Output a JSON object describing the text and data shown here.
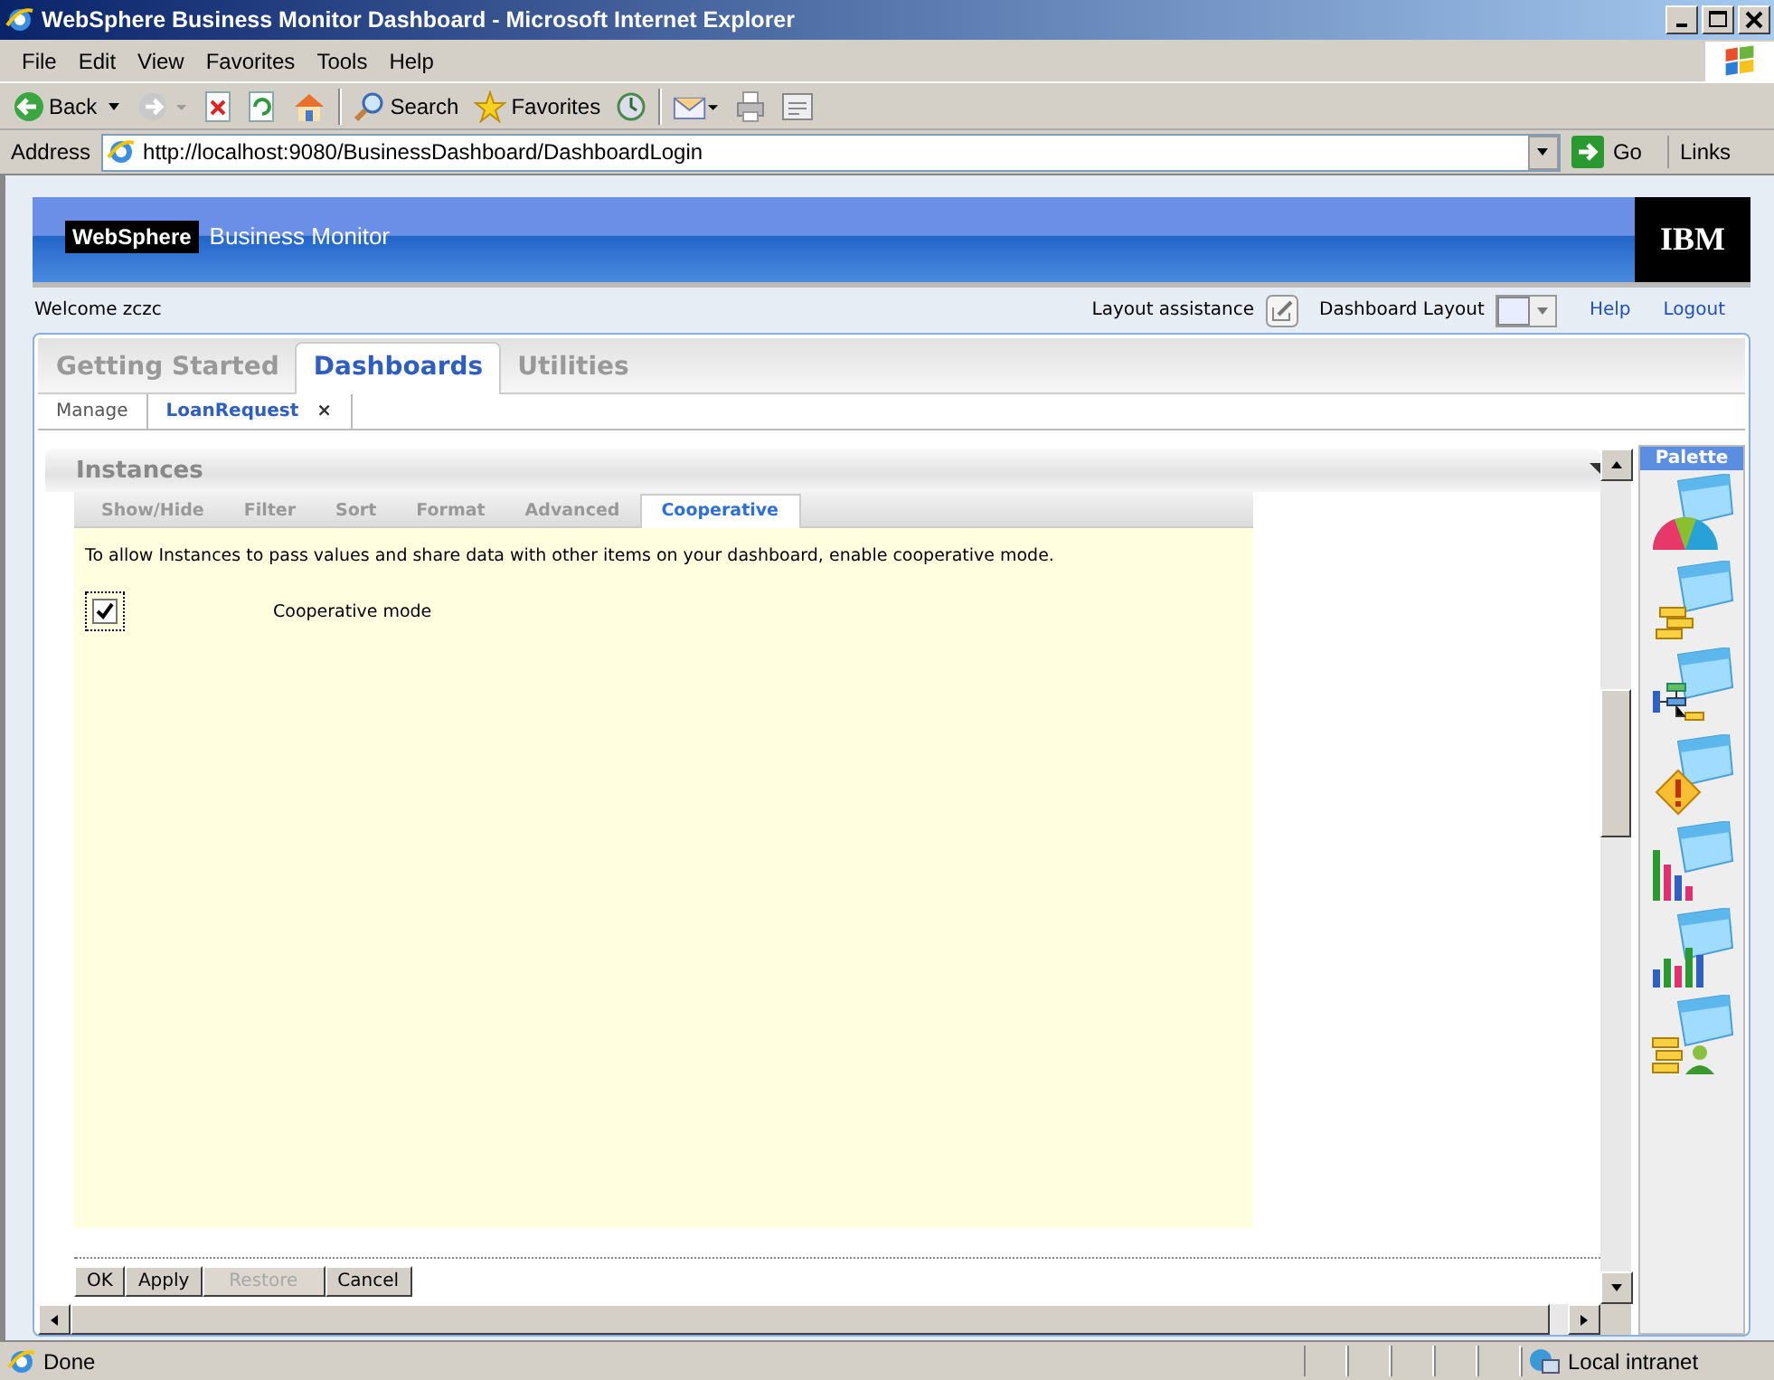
{
  "window": {
    "title": "WebSphere Business Monitor Dashboard - Microsoft Internet Explorer"
  },
  "menu": [
    "File",
    "Edit",
    "View",
    "Favorites",
    "Tools",
    "Help"
  ],
  "toolbar": [
    {
      "kind": "back",
      "label": "Back"
    },
    {
      "kind": "forward"
    },
    {
      "kind": "stop"
    },
    {
      "kind": "refresh"
    },
    {
      "kind": "home"
    },
    {
      "kind": "separator"
    },
    {
      "kind": "search",
      "label": "Search"
    },
    {
      "kind": "favorites",
      "label": "Favorites"
    },
    {
      "kind": "history"
    },
    {
      "kind": "separator"
    },
    {
      "kind": "mail"
    },
    {
      "kind": "print"
    },
    {
      "kind": "edit"
    }
  ],
  "address_bar": {
    "label": "Address",
    "url": "http://localhost:9080/BusinessDashboard/DashboardLogin",
    "go": "Go",
    "links": "Links"
  },
  "banner": {
    "brand": "WebSphere",
    "product": "Business Monitor",
    "logo": "IBM"
  },
  "header": {
    "welcome": "Welcome zczc",
    "layout_assistance": "Layout assistance",
    "dashboard_layout": "Dashboard Layout",
    "links": [
      "Help",
      "Logout"
    ]
  },
  "tabs": [
    {
      "label": "Getting Started",
      "selected": false
    },
    {
      "label": "Dashboards",
      "selected": true
    },
    {
      "label": "Utilities",
      "selected": false
    }
  ],
  "subtabs": [
    {
      "label": "Manage",
      "selected": false
    },
    {
      "label": "LoanRequest",
      "selected": true,
      "close": "×"
    }
  ],
  "portlet": {
    "title": "Instances",
    "settings_tabs": [
      {
        "label": "Show/Hide",
        "selected": false
      },
      {
        "label": "Filter",
        "selected": false
      },
      {
        "label": "Sort",
        "selected": false
      },
      {
        "label": "Format",
        "selected": false
      },
      {
        "label": "Advanced",
        "selected": false
      },
      {
        "label": "Cooperative",
        "selected": true
      }
    ],
    "description": "To allow Instances to pass values and share data with other items on your dashboard, enable cooperative mode.",
    "option": {
      "label": "Cooperative mode",
      "checked": true
    },
    "buttons": [
      {
        "label": "OK",
        "disabled": false
      },
      {
        "label": "Apply",
        "disabled": false
      },
      {
        "label": "Restore",
        "disabled": true
      },
      {
        "label": "Cancel",
        "disabled": false
      }
    ]
  },
  "palette": {
    "title": "Palette",
    "items": [
      {
        "kind": "gauge"
      },
      {
        "kind": "list"
      },
      {
        "kind": "diagram"
      },
      {
        "kind": "alert"
      },
      {
        "kind": "bars"
      },
      {
        "kind": "columns"
      },
      {
        "kind": "people"
      }
    ]
  },
  "status_bar": {
    "text": "Done",
    "zone": "Local intranet"
  }
}
